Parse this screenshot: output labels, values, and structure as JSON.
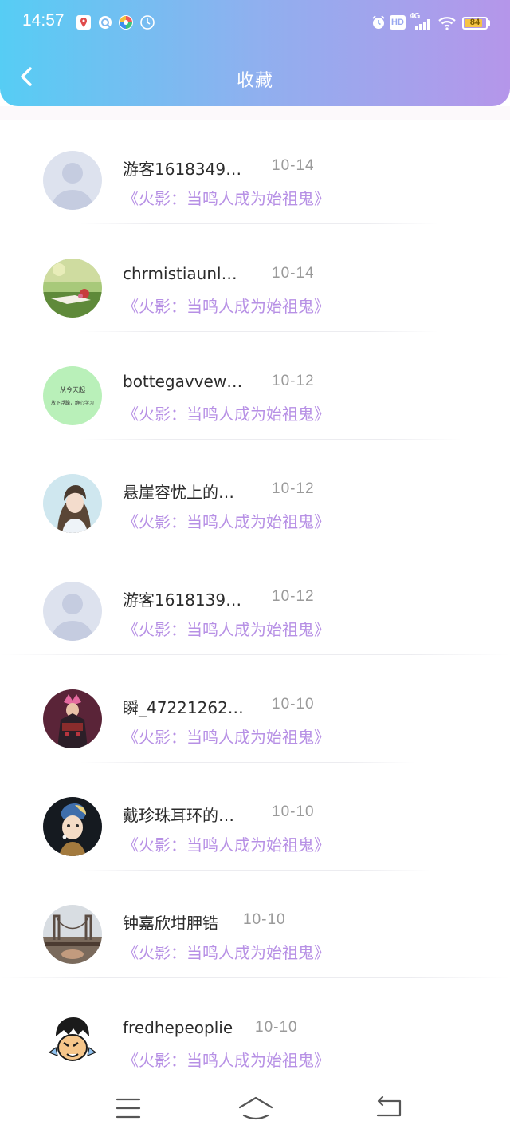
{
  "status_bar": {
    "time": "14:57",
    "network": "4G",
    "hd": "HD",
    "battery": 84
  },
  "header": {
    "title": "收藏"
  },
  "items": [
    {
      "username": "游客1618349…",
      "date": "10-14",
      "work": "《火影：当鸣人成为始祖鬼》",
      "avatar": "default-avatar"
    },
    {
      "username": "chrmistiaunl…",
      "date": "10-14",
      "work": "《火影：当鸣人成为始祖鬼》",
      "avatar": "meadow-photo-avatar"
    },
    {
      "username": "bottegavvew…",
      "date": "10-12",
      "work": "《火影：当鸣人成为始祖鬼》",
      "avatar": "text-avatar",
      "avatar_text": [
        "从今天起",
        "放下浮躁，静心学习"
      ]
    },
    {
      "username": "悬崖容忧上的…",
      "date": "10-12",
      "work": "《火影：当鸣人成为始祖鬼》",
      "avatar": "girl-photo-avatar"
    },
    {
      "username": "游客1618139…",
      "date": "10-12",
      "work": "《火影：当鸣人成为始祖鬼》",
      "avatar": "default-avatar"
    },
    {
      "username": "瞬_47221262…",
      "date": "10-10",
      "work": "《火影：当鸣人成为始祖鬼》",
      "avatar": "anime-warrior-avatar"
    },
    {
      "username": "戴珍珠耳环的…",
      "date": "10-10",
      "work": "《火影：当鸣人成为始祖鬼》",
      "avatar": "pearl-earring-avatar"
    },
    {
      "username": "钟嘉欣坩胛锆",
      "date": "10-10",
      "work": "《火影：当鸣人成为始祖鬼》",
      "avatar": "bridge-photo-avatar"
    },
    {
      "username": "fredhepeoplie",
      "date": "10-10",
      "work": "《火影：当鸣人成为始祖鬼》",
      "avatar": "cartoon-avatar"
    }
  ],
  "colors": {
    "header_gradient": [
      "#56cdf4",
      "#8fb0ef",
      "#b596ea"
    ],
    "work_title": "#b790e5",
    "date": "#9a9a9a"
  }
}
